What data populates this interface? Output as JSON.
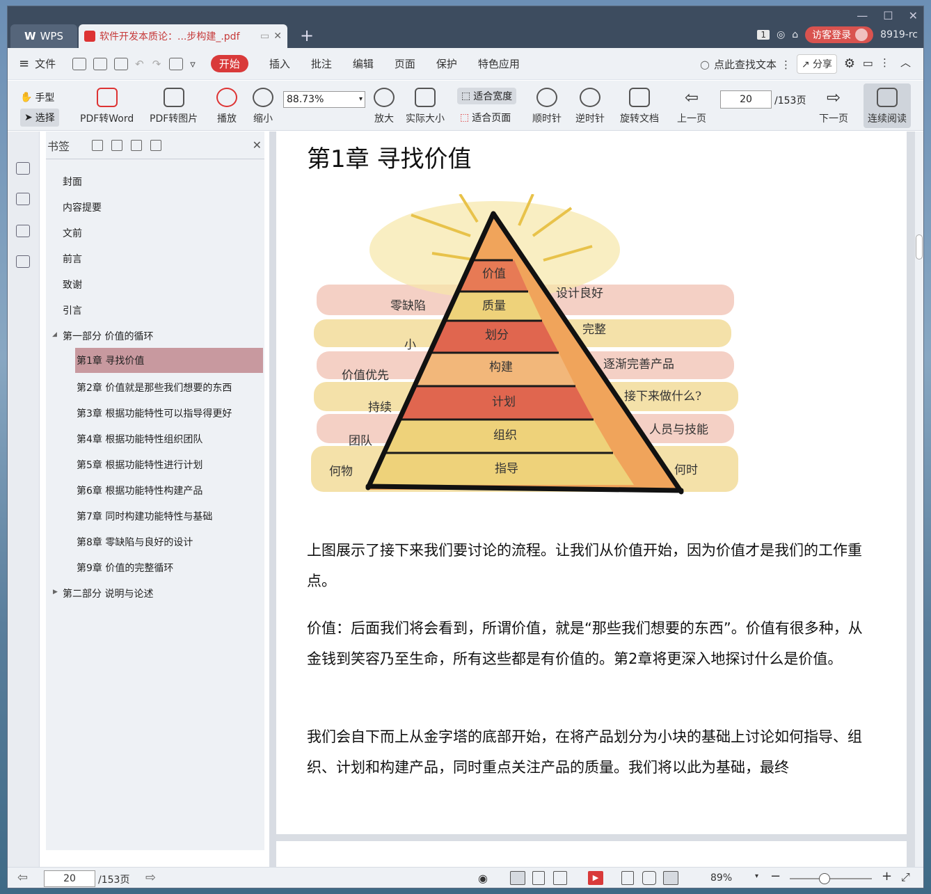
{
  "app": {
    "brand": "WPS",
    "tab_title": "软件开发本质论：...步构建_.pdf"
  },
  "titlebar": {
    "page_badge": "1",
    "login": "访客登录",
    "user": "8919-rc"
  },
  "menu": {
    "file": "文件",
    "items": [
      "开始",
      "插入",
      "批注",
      "编辑",
      "页面",
      "保护",
      "特色应用"
    ],
    "search": "点此查找文本",
    "share": "分享"
  },
  "toolbar": {
    "hand": "手型",
    "select": "选择",
    "pdf_word": "PDF转Word",
    "pdf_img": "PDF转图片",
    "play": "播放",
    "zoom_out": "缩小",
    "zoom_value": "88.73%",
    "zoom_in": "放大",
    "actual": "实际大小",
    "fit_width": "适合宽度",
    "fit_page": "适合页面",
    "cw": "顺时针",
    "ccw": "逆时针",
    "rotate_doc": "旋转文档",
    "prev": "上一页",
    "page_value": "20",
    "page_total": "/153页",
    "next": "下一页",
    "continuous": "连续阅读"
  },
  "bookmarks": {
    "title": "书签",
    "items": [
      "封面",
      "内容提要",
      "文前",
      "前言",
      "致谢",
      "引言",
      "第一部分 价值的循环",
      "第1章 寻找价值",
      "第2章 价值就是那些我们想要的东西",
      "第3章 根据功能特性可以指导得更好",
      "第4章 根据功能特性组织团队",
      "第5章 根据功能特性进行计划",
      "第6章 根据功能特性构建产品",
      "第7章 同时构建功能特性与基础",
      "第8章 零缺陷与良好的设计",
      "第9章 价值的完整循环",
      "第二部分 说明与论述"
    ]
  },
  "document": {
    "heading": "第1章  寻找价值",
    "pyramid_layers": [
      "价值",
      "质量",
      "划分",
      "构建",
      "计划",
      "组织",
      "指导"
    ],
    "left_labels": [
      "零缺陷",
      "小",
      "价值优先",
      "持续",
      "团队",
      "何物"
    ],
    "right_labels": [
      "设计良好",
      "完整",
      "逐渐完善产品",
      "接下来做什么?",
      "人员与技能",
      "何时"
    ],
    "paragraphs": [
      "上图展示了接下来我们要讨论的流程。让我们从价值开始，因为价值才是我们的工作重点。",
      "价值：后面我们将会看到，所谓价值，就是“那些我们想要的东西”。价值有很多种，从金钱到笑容乃至生命，所有这些都是有价值的。第2章将更深入地探讨什么是价值。",
      "我们会自下而上从金字塔的底部开始，在将产品划分为小块的基础上讨论如何指导、组织、计划和构建产品，同时重点关注产品的质量。我们将以此为基础，最终"
    ]
  },
  "status": {
    "page_value": "20",
    "page_total": "/153页",
    "zoom": "89%"
  },
  "colors": {
    "accent": "#d93a3a",
    "tab_bg": "#3d4c5f",
    "selection": "#c8999f"
  }
}
